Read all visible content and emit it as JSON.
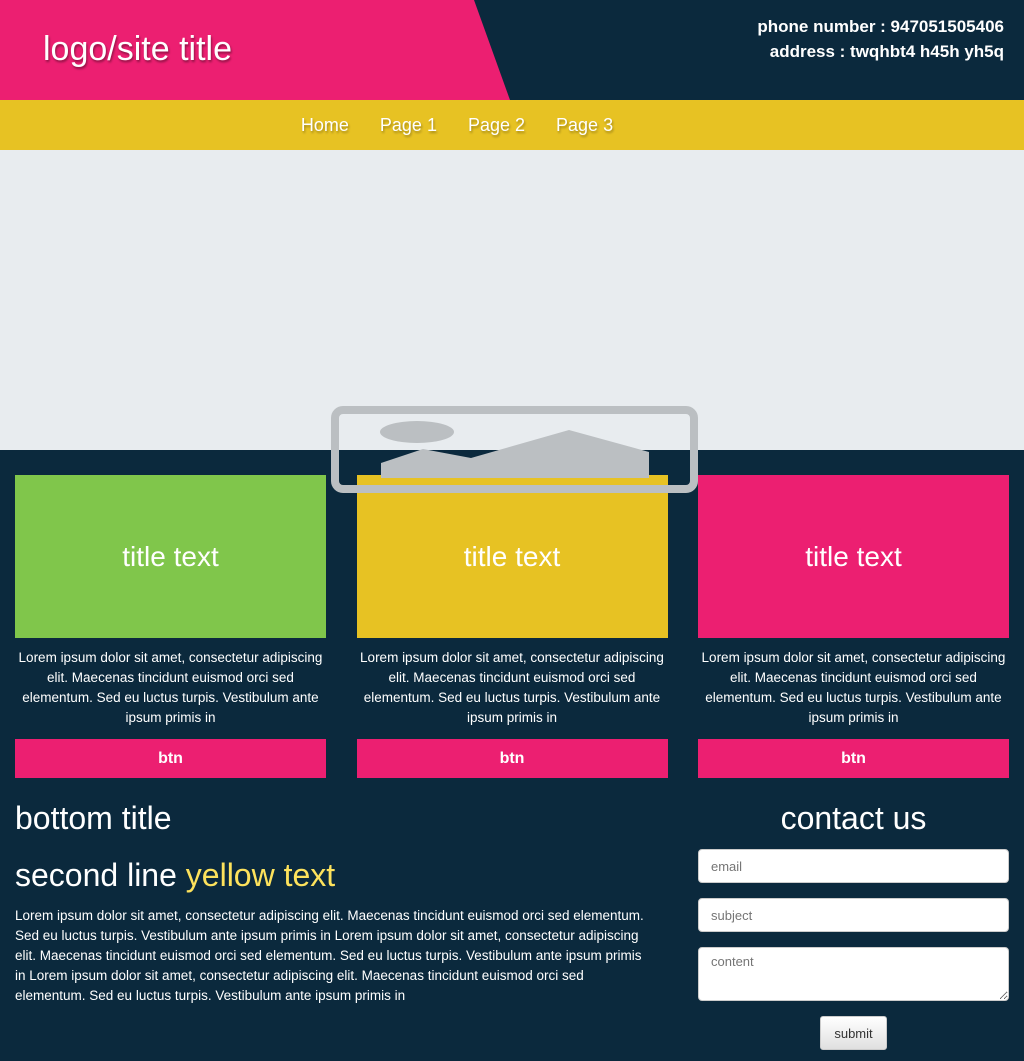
{
  "header": {
    "logo": "logo/site title",
    "phone": "phone number : 947051505406",
    "address": "address : twqhbt4 h45h yh5q"
  },
  "nav": [
    "Home",
    "Page 1",
    "Page 2",
    "Page 3"
  ],
  "hero": {
    "icon": "image-placeholder-icon"
  },
  "cards": [
    {
      "title": "title text",
      "color": "#80c64b",
      "text": "Lorem ipsum dolor sit amet, consectetur adipiscing elit. Maecenas tincidunt euismod orci sed elementum. Sed eu luctus turpis. Vestibulum ante ipsum primis in",
      "btn": "btn"
    },
    {
      "title": "title text",
      "color": "#e7c223",
      "text": "Lorem ipsum dolor sit amet, consectetur adipiscing elit. Maecenas tincidunt euismod orci sed elementum. Sed eu luctus turpis. Vestibulum ante ipsum primis in",
      "btn": "btn"
    },
    {
      "title": "title text",
      "color": "#ec1f71",
      "text": "Lorem ipsum dolor sit amet, consectetur adipiscing elit. Maecenas tincidunt euismod orci sed elementum. Sed eu luctus turpis. Vestibulum ante ipsum primis in",
      "btn": "btn"
    }
  ],
  "bottom": {
    "title": "bottom title",
    "second_line": "second line",
    "yellow_text": "yellow text",
    "text": "Lorem ipsum dolor sit amet, consectetur adipiscing elit. Maecenas tincidunt euismod orci sed elementum. Sed eu luctus turpis. Vestibulum ante ipsum primis in Lorem ipsum dolor sit amet, consectetur adipiscing elit. Maecenas tincidunt euismod orci sed elementum. Sed eu luctus turpis. Vestibulum ante ipsum primis in Lorem ipsum dolor sit amet, consectetur adipiscing elit. Maecenas tincidunt euismod orci sed elementum. Sed eu luctus turpis. Vestibulum ante ipsum primis in"
  },
  "contact": {
    "title": "contact us",
    "email_placeholder": "email",
    "subject_placeholder": "subject",
    "content_placeholder": "content",
    "submit": "submit"
  }
}
